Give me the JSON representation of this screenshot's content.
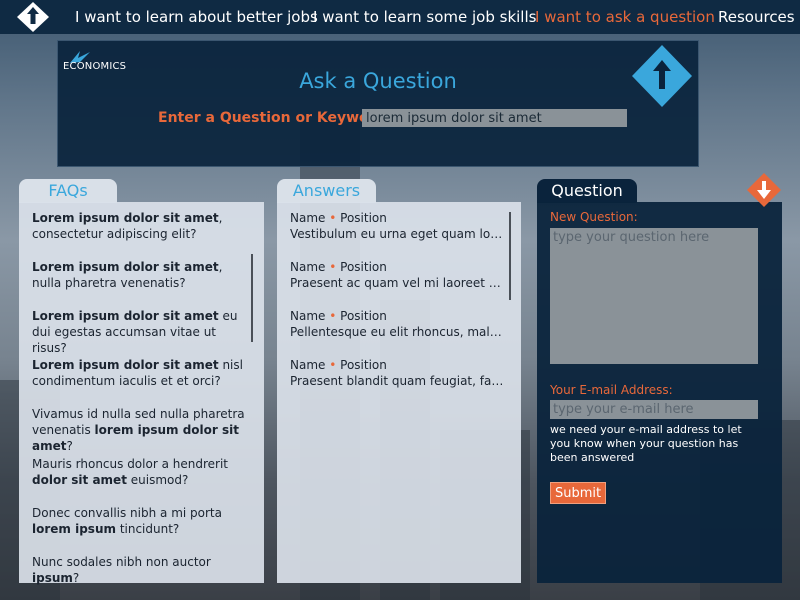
{
  "nav": {
    "links": [
      {
        "label": "I want to learn about better jobs",
        "active": false
      },
      {
        "label": "I want to learn some job skills",
        "active": false
      },
      {
        "label": "I want to ask a question",
        "active": true
      },
      {
        "label": "Resources",
        "active": false
      }
    ],
    "logo_icon": "ascend-nyc-up-arrow-icon"
  },
  "header": {
    "brand_text": "ECONOMICS",
    "title": "Ask a Question",
    "search_label": "Enter a Question or Keyword:",
    "search_value": "lorem ipsum dolor sit amet",
    "logo_icon": "ascend-nyc-logo-icon"
  },
  "faqs": {
    "tab_label": "FAQs",
    "items": [
      [
        "Lorem ipsum dolor sit amet",
        ",",
        " consectetur adipiscing elit?"
      ],
      [
        "Lorem ipsum dolor sit amet",
        ",",
        " nulla pharetra venenatis?"
      ],
      [
        "Lorem ipsum dolor sit amet",
        " eu dui egestas accumsan vitae ut risus?",
        ""
      ],
      [
        "Lorem ipsum dolor sit amet",
        " nisl condimentum iaculis et et orci?",
        ""
      ],
      [
        "Vivamus id nulla sed nulla pharetra venenatis ",
        "lorem ipsum dolor sit amet",
        "?"
      ],
      [
        "Mauris rhoncus dolor a hendrerit ",
        "dolor sit amet",
        " euismod?"
      ],
      [
        "Donec convallis nibh a mi porta ",
        "lorem ipsum",
        " tincidunt?"
      ],
      [
        "Nunc sodales nibh non auctor ",
        "ipsum",
        "?"
      ]
    ]
  },
  "answers": {
    "tab_label": "Answers",
    "items": [
      {
        "name": "Name",
        "sep": "•",
        "position": "Position",
        "body": "Vestibulum eu urna eget quam lobortis"
      },
      {
        "name": "Name",
        "sep": "•",
        "position": "Position",
        "body": "Praesent ac quam vel mi laoreet consequat"
      },
      {
        "name": "Name",
        "sep": "•",
        "position": "Position",
        "body": "Pellentesque eu elit rhoncus, malesuada"
      },
      {
        "name": "Name",
        "sep": "•",
        "position": "Position",
        "body": "Praesent blandit quam feugiat, facilisis"
      }
    ]
  },
  "question": {
    "tab_label": "Question",
    "new_label": "New Question:",
    "new_placeholder": "type your question here",
    "email_label": "Your E-mail Address:",
    "email_placeholder": "type your e-mail here",
    "email_note": "we need your e-mail address to let you know when your question has been answered",
    "submit_label": "Submit",
    "scroll_icon": "down-arrow-icon"
  },
  "colors": {
    "nav_bg": "#0f2a43",
    "accent_orange": "#e8683a",
    "accent_blue": "#3aa7dc",
    "panel_dark": "#0a233c",
    "panel_light": "#d9e0e8"
  }
}
